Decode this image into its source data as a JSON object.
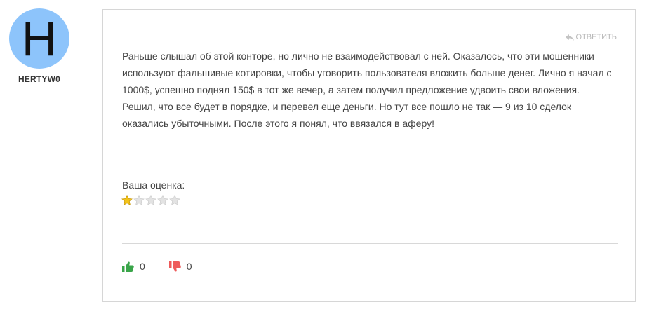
{
  "author": {
    "avatar_letter": "H",
    "avatar_color": "#8dc4fb",
    "username": "HERTYW0"
  },
  "comment": {
    "reply_label": "ОТВЕТИТЬ",
    "reply_icon": "reply-icon",
    "text": "Раньше слышал об этой конторе, но лично не взаимодействовал с ней. Оказалось, что эти мошенники используют фальшивые котировки, чтобы уговорить пользователя вложить больше денег. Лично я начал с 1000$, успешно поднял 150$ в тот же вечер, а затем получил предложение удвоить свои вложения. Решил, что все будет в порядке, и перевел еще деньги. Но тут все пошло не так — 9 из 10 сделок оказались убыточными. После этого я понял, что ввязался в аферу!",
    "rating_label": "Ваша оценка:",
    "rating": 1,
    "rating_max": 5,
    "star_filled_color": "#f3c318",
    "star_empty_color": "#e3e3e3"
  },
  "votes": {
    "likes": "0",
    "dislikes": "0",
    "like_icon": "thumbs-up-icon",
    "dislike_icon": "thumbs-down-icon",
    "like_color": "#3aa54a",
    "dislike_color": "#ee5a5a"
  }
}
